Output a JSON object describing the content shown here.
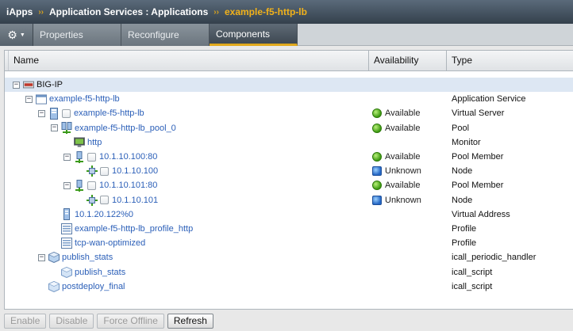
{
  "breadcrumb": {
    "root": "iApps",
    "section": "Application Services : Applications",
    "current": "example-f5-http-lb",
    "separator": "››"
  },
  "tabs": [
    {
      "label": "Properties",
      "active": false
    },
    {
      "label": "Reconfigure",
      "active": false
    },
    {
      "label": "Components",
      "active": true
    }
  ],
  "table": {
    "columns": {
      "name": "Name",
      "availability": "Availability",
      "type": "Type"
    },
    "rows": [
      {
        "name": "BIG-IP",
        "availability": "",
        "status": "",
        "type": "",
        "level": 0,
        "toggle": "−",
        "icon": "bigip-device-icon",
        "link": false,
        "checkbox": false
      },
      {
        "name": "example-f5-http-lb",
        "availability": "",
        "status": "",
        "type": "Application Service",
        "level": 1,
        "toggle": "−",
        "icon": "application-service-icon",
        "link": true,
        "checkbox": false
      },
      {
        "name": "example-f5-http-lb",
        "availability": "Available",
        "status": "green",
        "type": "Virtual Server",
        "level": 2,
        "toggle": "−",
        "icon": "virtual-server-icon",
        "link": true,
        "checkbox": true
      },
      {
        "name": "example-f5-http-lb_pool_0",
        "availability": "Available",
        "status": "green",
        "type": "Pool",
        "level": 3,
        "toggle": "−",
        "icon": "pool-icon",
        "link": true,
        "checkbox": false
      },
      {
        "name": "http",
        "availability": "",
        "status": "",
        "type": "Monitor",
        "level": 4,
        "toggle": "",
        "icon": "monitor-icon",
        "link": true,
        "checkbox": false
      },
      {
        "name": "10.1.10.100:80",
        "availability": "Available",
        "status": "green",
        "type": "Pool Member",
        "level": 4,
        "toggle": "−",
        "icon": "pool-member-icon",
        "link": true,
        "checkbox": true
      },
      {
        "name": "10.1.10.100",
        "availability": "Unknown",
        "status": "blue",
        "type": "Node",
        "level": 5,
        "toggle": "",
        "icon": "node-icon",
        "link": true,
        "checkbox": true
      },
      {
        "name": "10.1.10.101:80",
        "availability": "Available",
        "status": "green",
        "type": "Pool Member",
        "level": 4,
        "toggle": "−",
        "icon": "pool-member-icon",
        "link": true,
        "checkbox": true
      },
      {
        "name": "10.1.10.101",
        "availability": "Unknown",
        "status": "blue",
        "type": "Node",
        "level": 5,
        "toggle": "",
        "icon": "node-icon",
        "link": true,
        "checkbox": true
      },
      {
        "name": "10.1.20.122%0",
        "availability": "",
        "status": "",
        "type": "Virtual Address",
        "level": 3,
        "toggle": "",
        "icon": "virtual-address-icon",
        "link": true,
        "checkbox": false
      },
      {
        "name": "example-f5-http-lb_profile_http",
        "availability": "",
        "status": "",
        "type": "Profile",
        "level": 3,
        "toggle": "",
        "icon": "profile-icon",
        "link": true,
        "checkbox": false
      },
      {
        "name": "tcp-wan-optimized",
        "availability": "",
        "status": "",
        "type": "Profile",
        "level": 3,
        "toggle": "",
        "icon": "profile-icon",
        "link": true,
        "checkbox": false
      },
      {
        "name": "publish_stats",
        "availability": "",
        "status": "",
        "type": "icall_periodic_handler",
        "level": 2,
        "toggle": "−",
        "icon": "icall-handler-icon",
        "link": true,
        "checkbox": false
      },
      {
        "name": "publish_stats",
        "availability": "",
        "status": "",
        "type": "icall_script",
        "level": 3,
        "toggle": "",
        "icon": "icall-script-icon",
        "link": true,
        "checkbox": false
      },
      {
        "name": "postdeploy_final",
        "availability": "",
        "status": "",
        "type": "icall_script",
        "level": 2,
        "toggle": "",
        "icon": "icall-script-icon",
        "link": true,
        "checkbox": false
      }
    ]
  },
  "buttons": [
    {
      "label": "Enable",
      "enabled": false
    },
    {
      "label": "Disable",
      "enabled": false
    },
    {
      "label": "Force Offline",
      "enabled": false
    },
    {
      "label": "Refresh",
      "enabled": true
    }
  ]
}
